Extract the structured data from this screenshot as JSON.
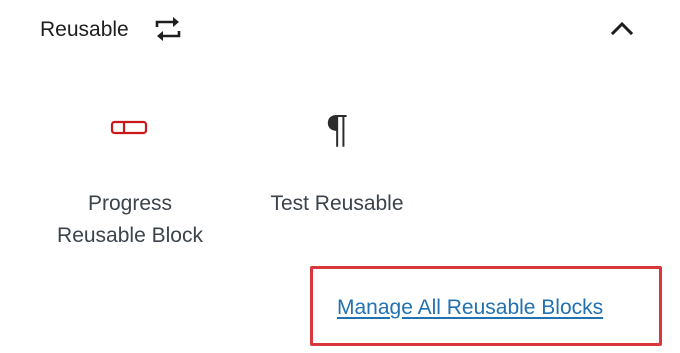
{
  "panel": {
    "title": "Reusable",
    "title_icon": "reusable-block-icon",
    "toggle_icon": "chevron-up-icon",
    "expanded": true
  },
  "blocks": [
    {
      "label": "Progress Reusable Block",
      "label_lines": [
        "Progress",
        "Reusable Block"
      ],
      "icon": "progress-bar-icon",
      "icon_color": "#cc1818"
    },
    {
      "label": "Test Reusable",
      "label_lines": [
        "Test Reusable"
      ],
      "icon": "paragraph-icon",
      "icon_glyph": "¶"
    }
  ],
  "manage_link": {
    "label": "Manage All Reusable Blocks",
    "color": "#2271b1",
    "highlight_color": "#d9363e"
  }
}
